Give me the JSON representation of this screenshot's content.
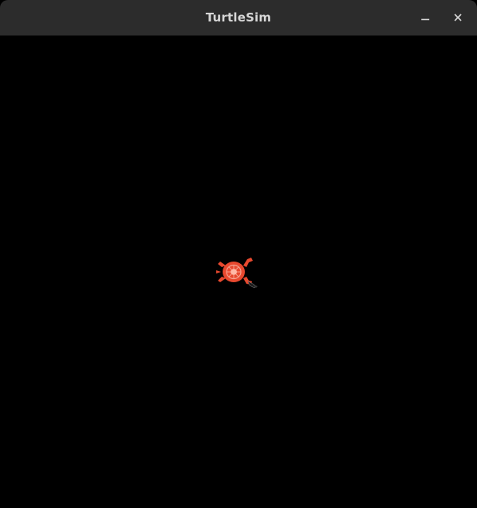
{
  "window": {
    "title": "TurtleSim",
    "background_color": "#000000",
    "titlebar_color": "#2c2c2c",
    "title_color": "#d6d6d6"
  },
  "controls": {
    "minimize_icon": "minimize-icon",
    "close_icon": "close-icon"
  },
  "turtle": {
    "icon": "turtle-icon",
    "shell_color": "#e8492f",
    "limb_color": "#e8492f",
    "head_color": "#1c1c1c"
  }
}
